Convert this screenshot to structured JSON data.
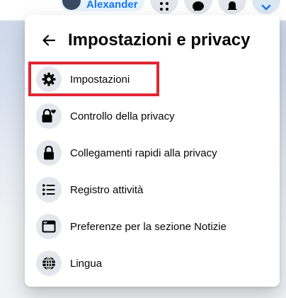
{
  "topbar": {
    "profile_name": "Alexander",
    "buttons": [
      {
        "icon": "menu-grid-icon"
      },
      {
        "icon": "messenger-icon"
      },
      {
        "icon": "notifications-bell-icon"
      },
      {
        "icon": "account-chevron-icon"
      }
    ]
  },
  "menu": {
    "title": "Impostazioni e privacy",
    "back_icon": "arrow-left-icon",
    "items": [
      {
        "label": "Impostazioni",
        "icon": "gear-icon",
        "highlighted": true
      },
      {
        "label": "Controllo della privacy",
        "icon": "lock-heart-icon"
      },
      {
        "label": "Collegamenti rapidi alla privacy",
        "icon": "lock-icon"
      },
      {
        "label": "Registro attività",
        "icon": "list-icon"
      },
      {
        "label": "Preferenze per la sezione Notizie",
        "icon": "news-feed-icon"
      },
      {
        "label": "Lingua",
        "icon": "globe-icon"
      }
    ]
  },
  "colors": {
    "highlight_border": "#e02633",
    "icon_background": "#e4e6eb",
    "text_primary": "#050505",
    "accent": "#1877f2"
  }
}
